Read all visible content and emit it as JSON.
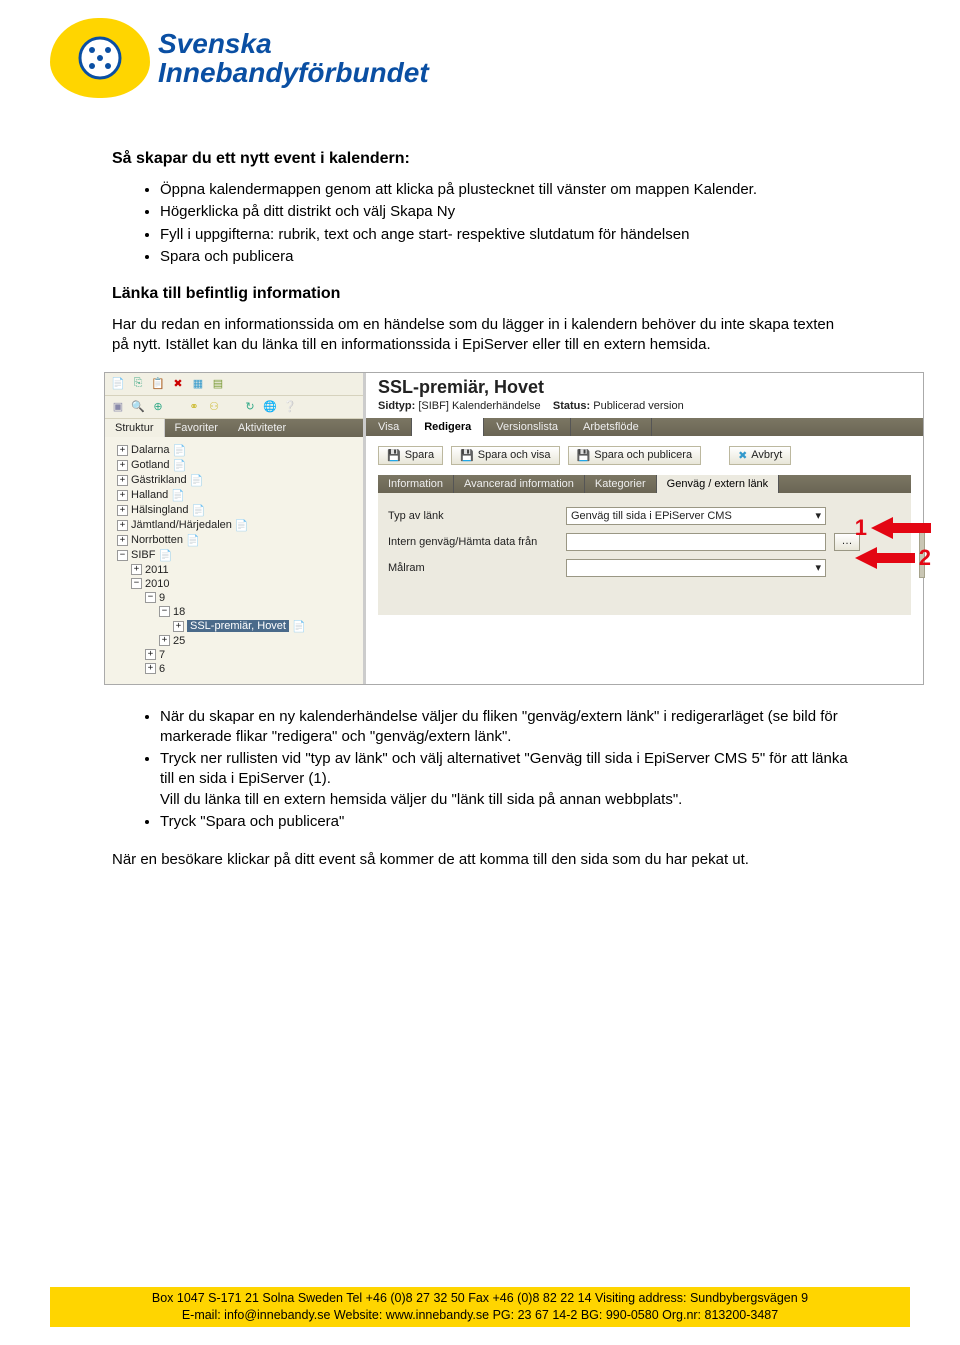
{
  "logo": {
    "line1": "Svenska",
    "line2": "Innebandyförbundet"
  },
  "h1": "Så skapar du ett nytt event i kalendern:",
  "list1": [
    "Öppna kalendermappen genom att klicka på plustecknet till vänster om mappen Kalender.",
    "Högerklicka på ditt distrikt och välj Skapa Ny",
    "Fyll i uppgifterna: rubrik, text och ange start- respektive slutdatum för händelsen",
    "Spara och publicera"
  ],
  "h2": "Länka till befintlig information",
  "p1": "Har du redan en informationssida om en händelse som du lägger in i kalendern behöver du inte skapa texten på nytt. Istället kan du länka till en informationssida i EpiServer eller till en extern hemsida.",
  "screenshot": {
    "title": "SSL-premiär, Hovet",
    "sidtyp_label": "Sidtyp:",
    "sidtyp_value": "[SIBF] Kalenderhändelse",
    "status_label": "Status:",
    "status_value": "Publicerad version",
    "left_tabs": [
      "Struktur",
      "Favoriter",
      "Aktiviteter"
    ],
    "edit_tabs": [
      "Visa",
      "Redigera",
      "Versionslista",
      "Arbetsflöde"
    ],
    "buttons": {
      "save": "Spara",
      "save_view": "Spara och visa",
      "save_pub": "Spara och publicera",
      "cancel": "Avbryt"
    },
    "sub_tabs": [
      "Information",
      "Avancerad information",
      "Kategorier",
      "Genväg / extern länk"
    ],
    "form": {
      "row1_label": "Typ av länk",
      "row1_value": "Genväg till sida i EPiServer CMS",
      "row2_label": "Intern genväg/Hämta data från",
      "row3_label": "Målram"
    },
    "tree": [
      {
        "ind": 1,
        "exp": "+",
        "label": "Dalarna",
        "icon": "📄"
      },
      {
        "ind": 1,
        "exp": "+",
        "label": "Gotland",
        "icon": "📄"
      },
      {
        "ind": 1,
        "exp": "+",
        "label": "Gästrikland",
        "icon": "📄"
      },
      {
        "ind": 1,
        "exp": "+",
        "label": "Halland",
        "icon": "📄"
      },
      {
        "ind": 1,
        "exp": "+",
        "label": "Hälsingland",
        "icon": "📄"
      },
      {
        "ind": 1,
        "exp": "+",
        "label": "Jämtland/Härjedalen",
        "icon": "📄"
      },
      {
        "ind": 1,
        "exp": "+",
        "label": "Norrbotten",
        "icon": "📄"
      },
      {
        "ind": 1,
        "exp": "−",
        "label": "SIBF",
        "icon": "📄"
      },
      {
        "ind": 2,
        "exp": "+",
        "label": "2011",
        "icon": ""
      },
      {
        "ind": 2,
        "exp": "−",
        "label": "2010",
        "icon": ""
      },
      {
        "ind": 3,
        "exp": "−",
        "label": "9",
        "icon": ""
      },
      {
        "ind": 4,
        "exp": "−",
        "label": "18",
        "icon": ""
      },
      {
        "ind": 5,
        "exp": "+",
        "label": "SSL-premiär, Hovet",
        "icon": "📄",
        "sel": true
      },
      {
        "ind": 4,
        "exp": "+",
        "label": "25",
        "icon": ""
      },
      {
        "ind": 3,
        "exp": "+",
        "label": "7",
        "icon": ""
      },
      {
        "ind": 3,
        "exp": "+",
        "label": "6",
        "icon": ""
      }
    ],
    "markers": {
      "m1": "1",
      "m2": "2"
    }
  },
  "list2": [
    "När du skapar en ny kalenderhändelse väljer du fliken \"genväg/extern länk\" i redigerarläget (se bild för markerade flikar \"redigera\" och \"genväg/extern länk\".",
    "Tryck ner rullisten vid \"typ av länk\" och välj alternativet \"Genväg till sida i EpiServer CMS 5\" för att länka till en sida i EpiServer (1).\nVill du länka till en extern hemsida väljer du \"länk till sida på annan webbplats\".",
    "Tryck \"Spara och publicera\""
  ],
  "p2": "När en besökare klickar på ditt event så kommer de att komma till den sida som du har pekat ut.",
  "footer": {
    "line1": "Box 1047 S-171 21 Solna Sweden  Tel +46 (0)8 27 32 50 Fax +46 (0)8 82 22 14 Visiting address: Sundbybergsvägen 9",
    "line2": "E-mail: info@innebandy.se Website: www.innebandy.se  PG: 23 67 14-2 BG: 990-0580 Org.nr: 813200-3487"
  }
}
